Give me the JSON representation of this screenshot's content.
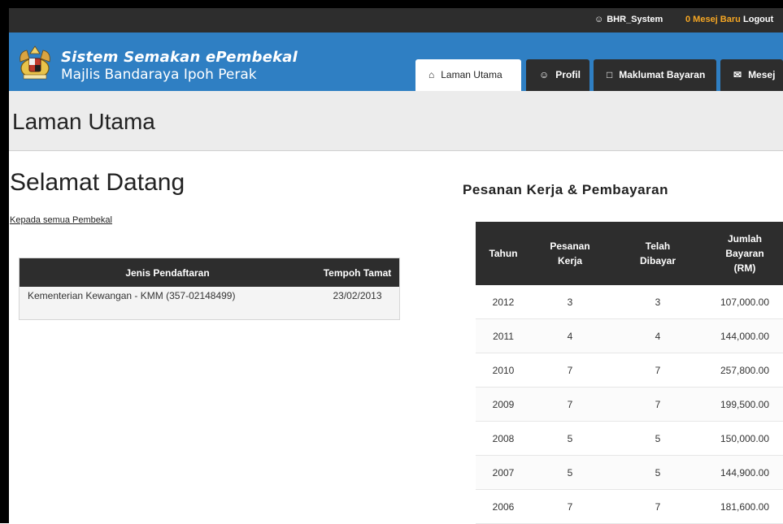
{
  "topbar": {
    "user_name": "BHR_System",
    "messages_text": "0 Mesej Baru",
    "logout_label": "Logout"
  },
  "brand": {
    "title": "Sistem Semakan ePembekal",
    "subtitle": "Majlis Bandaraya Ipoh Perak"
  },
  "nav": {
    "tabs": [
      {
        "label": "Laman Utama",
        "icon": "home-icon",
        "active": true
      },
      {
        "label": "Profil",
        "icon": "user-icon",
        "active": false
      },
      {
        "label": "Maklumat Bayaran",
        "icon": "clipboard-icon",
        "active": false
      },
      {
        "label": "Mesej",
        "icon": "envelope-icon",
        "active": false
      }
    ]
  },
  "page": {
    "title": "Laman Utama",
    "welcome": "Selamat Datang",
    "greeting": "Kepada semua Pembekal"
  },
  "registration_table": {
    "headers": [
      "Jenis Pendaftaran",
      "Tempoh Tamat"
    ],
    "rows": [
      {
        "type": "Kementerian Kewangan - KMM (357-02148499)",
        "expiry": "23/02/2013"
      }
    ]
  },
  "payments": {
    "title": "Pesanan Kerja & Pembayaran",
    "headers": {
      "year": "Tahun",
      "orders_line1": "Pesanan",
      "orders_line2": "Kerja",
      "paid_line1": "Telah",
      "paid_line2": "Dibayar",
      "amount_line1": "Jumlah",
      "amount_line2": "Bayaran",
      "amount_line3": "(RM)"
    },
    "rows": [
      {
        "year": "2012",
        "orders": "3",
        "paid": "3",
        "amount": "107,000.00"
      },
      {
        "year": "2011",
        "orders": "4",
        "paid": "4",
        "amount": "144,000.00"
      },
      {
        "year": "2010",
        "orders": "7",
        "paid": "7",
        "amount": "257,800.00"
      },
      {
        "year": "2009",
        "orders": "7",
        "paid": "7",
        "amount": "199,500.00"
      },
      {
        "year": "2008",
        "orders": "5",
        "paid": "5",
        "amount": "150,000.00"
      },
      {
        "year": "2007",
        "orders": "5",
        "paid": "5",
        "amount": "144,900.00"
      },
      {
        "year": "2006",
        "orders": "7",
        "paid": "7",
        "amount": "181,600.00"
      }
    ]
  },
  "colors": {
    "header_blue": "#2f7fc3",
    "dark_bar": "#2d2d2d",
    "messages_orange": "#f5a623"
  }
}
